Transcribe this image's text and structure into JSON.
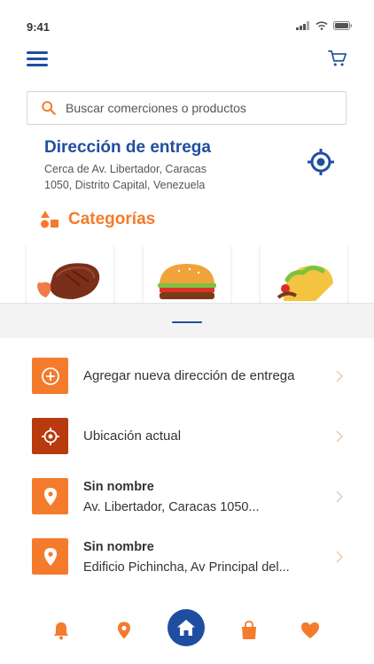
{
  "status_bar": {
    "time": "9:41"
  },
  "search": {
    "placeholder": "Buscar comerciones o productos"
  },
  "delivery": {
    "title": "Dirección de entrega",
    "address_line1": "Cerca de Av. Libertador, Caracas",
    "address_line2": "1050, Distrito Capital, Venezuela"
  },
  "categories": {
    "title": "Categorías",
    "cards": [
      "meat",
      "burger",
      "taco"
    ]
  },
  "sheet": {
    "items": [
      {
        "icon": "add-circle-icon",
        "label": "Agregar nueva dirección de entrega"
      },
      {
        "icon": "crosshair-icon",
        "label": "Ubicación actual"
      },
      {
        "icon": "location-pin-icon",
        "name": "Sin nombre",
        "detail": "Av. Libertador, Caracas 1050..."
      },
      {
        "icon": "location-pin-icon",
        "name": "Sin nombre",
        "detail": "Edificio Pichincha, Av Principal del..."
      }
    ]
  },
  "bottom_nav": [
    "bell-icon",
    "location-pin-icon",
    "home-icon",
    "shopping-bag-icon",
    "heart-icon"
  ],
  "colors": {
    "primary": "#1f4ea1",
    "accent": "#f47b2c",
    "accent_dark": "#b83a0e"
  }
}
